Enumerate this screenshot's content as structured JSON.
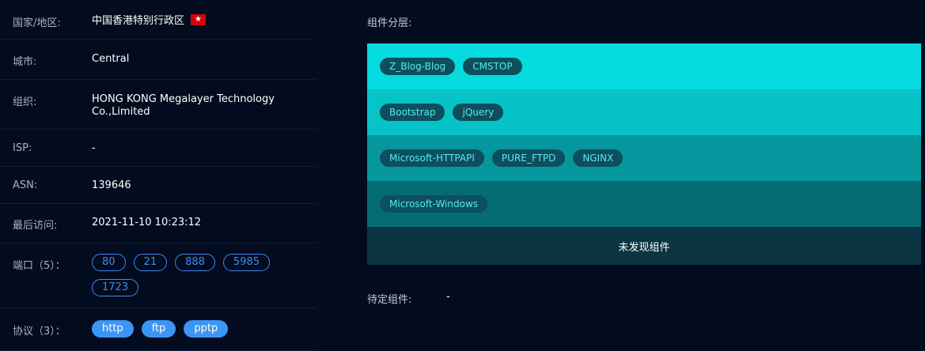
{
  "info": {
    "country": {
      "label": "国家/地区:",
      "value": "中国香港特别行政区",
      "flag_symbol": "★"
    },
    "city": {
      "label": "城市:",
      "value": "Central"
    },
    "org": {
      "label": "组织:",
      "value_line1": "HONG KONG Megalayer Technology",
      "value_line2": "Co.,Limited"
    },
    "isp": {
      "label": "ISP:",
      "value": "-"
    },
    "asn": {
      "label": "ASN:",
      "value": "139646"
    },
    "last_visit": {
      "label": "最后访问:",
      "value": "2021-11-10 10:23:12"
    },
    "ports": {
      "label": "端口（5）：",
      "items": [
        "80",
        "21",
        "888",
        "5985",
        "1723"
      ]
    },
    "protocols": {
      "label": "协议（3）：",
      "items": [
        "http",
        "ftp",
        "pptp"
      ]
    }
  },
  "components": {
    "title": "组件分层:",
    "layers": [
      {
        "color": "#05dbdf",
        "items": [
          "Z_Blog-Blog",
          "CMSTOP"
        ]
      },
      {
        "color": "#06c3c8",
        "items": [
          "Bootstrap",
          "jQuery"
        ]
      },
      {
        "color": "#05979d",
        "items": [
          "Microsoft-HTTPAPI",
          "PURE_FTPD",
          "NGINX"
        ]
      },
      {
        "color": "#066c74",
        "items": [
          "Microsoft-Windows"
        ]
      }
    ],
    "empty_text": "未发现组件",
    "pending_label": "待定组件:",
    "pending_value": "-"
  },
  "colors": {
    "background": "#030b1e",
    "port_outline": "#3a8cf0",
    "protocol_fill": "#3b95f4",
    "component_chip": "#0d4f5c",
    "component_chip_text": "#58e8f2"
  }
}
